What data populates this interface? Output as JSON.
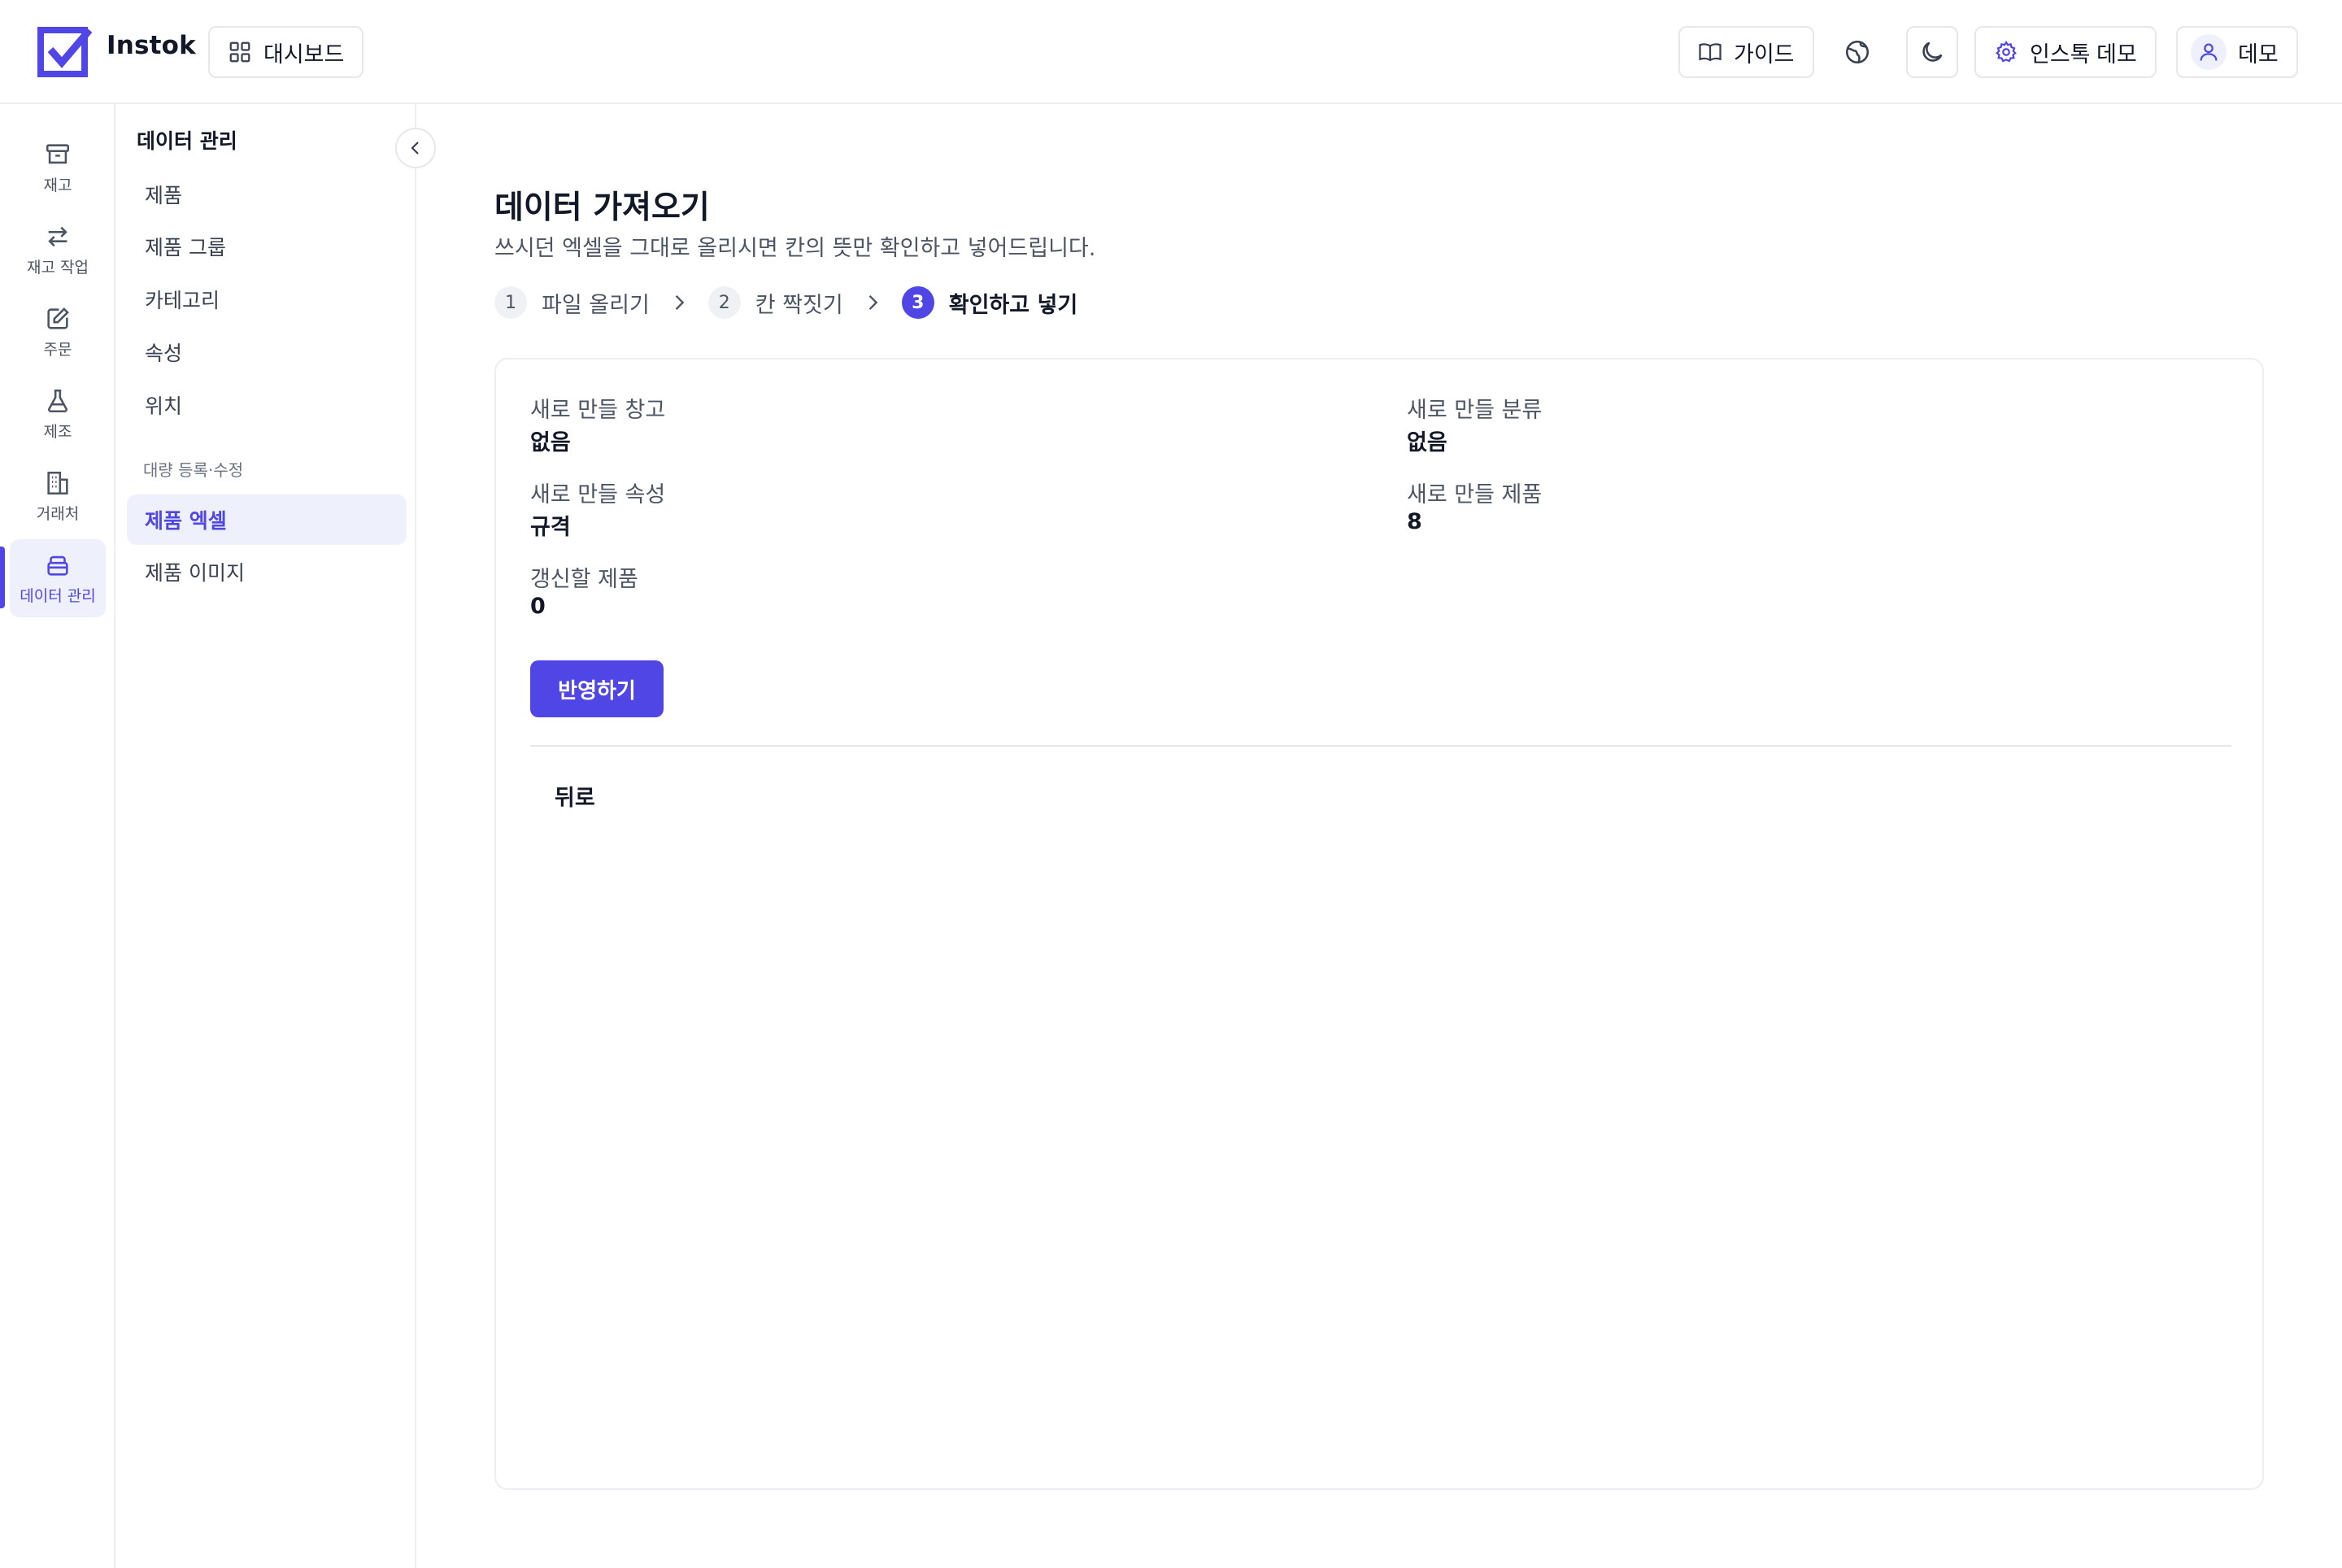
{
  "header": {
    "brand": "Instok",
    "dashboard_label": "대시보드",
    "guide_label": "가이드",
    "workspace_label": "인스톡 데모",
    "user_label": "데모"
  },
  "rail": {
    "items": [
      {
        "label": "재고",
        "icon": "archive-icon"
      },
      {
        "label": "재고 작업",
        "icon": "swap-arrows-icon"
      },
      {
        "label": "주문",
        "icon": "edit-note-icon"
      },
      {
        "label": "제조",
        "icon": "flask-icon"
      },
      {
        "label": "거래처",
        "icon": "building-icon"
      },
      {
        "label": "데이터 관리",
        "icon": "database-icon",
        "active": true
      }
    ]
  },
  "subnav": {
    "title": "데이터 관리",
    "items": [
      "제품",
      "제품 그룹",
      "카테고리",
      "속성",
      "위치"
    ],
    "section_label": "대량 등록·수정",
    "bulk_items": [
      "제품 엑셀",
      "제품 이미지"
    ],
    "active_item": "제품 엑셀"
  },
  "main": {
    "title": "데이터 가져오기",
    "subtitle": "쓰시던 엑셀을 그대로 올리시면 칸의 뜻만 확인하고 넣어드립니다.",
    "steps": [
      {
        "num": "1",
        "label": "파일 올리기"
      },
      {
        "num": "2",
        "label": "칸 짝짓기"
      },
      {
        "num": "3",
        "label": "확인하고 넣기",
        "active": true
      }
    ],
    "summary": {
      "new_warehouse_label": "새로 만들 창고",
      "new_warehouse_value": "없음",
      "new_category_label": "새로 만들 분류",
      "new_category_value": "없음",
      "new_attribute_label": "새로 만들 속성",
      "new_attribute_value": "규격",
      "new_product_label": "새로 만들 제품",
      "new_product_value": "8",
      "update_product_label": "갱신할 제품",
      "update_product_value": "0"
    },
    "apply_label": "반영하기",
    "back_label": "뒤로"
  },
  "colors": {
    "accent": "#4f46e5",
    "accent_soft": "#eef0fc",
    "border": "#eceef2",
    "text": "#111827",
    "muted": "#4b5563"
  }
}
